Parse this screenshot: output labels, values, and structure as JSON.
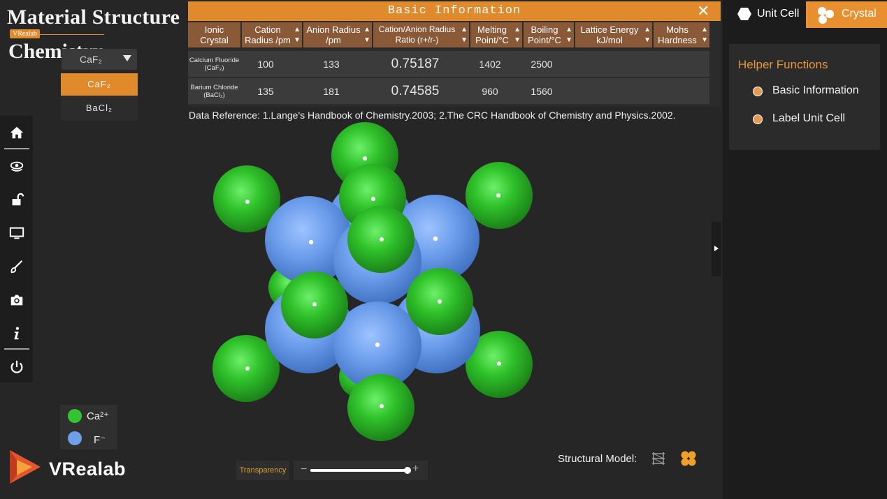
{
  "app": {
    "title_line1": "Material Structure",
    "title_line2": "Chemistry",
    "badge": "VRealab"
  },
  "crystal_select": {
    "selected": "CaF₂",
    "options": [
      "CaF₂",
      "BaCl₂"
    ]
  },
  "toolbar": {
    "items": [
      "home",
      "view",
      "unlock",
      "monitor",
      "brush",
      "camera",
      "info",
      "power"
    ]
  },
  "info_panel": {
    "title": "Basic Information",
    "close": "✕",
    "sort_glyph": "▲\n▼",
    "columns": [
      "Ionic Crystal",
      "Cation Radius /pm",
      "Anion Radius /pm",
      "Cation/Anion Radius Ratio (r+/r-)",
      "Melting Point/°C",
      "Boiling Point/°C",
      "Lattice Energy kJ/mol",
      "Mohs Hardness"
    ],
    "rows": [
      {
        "name": "Calcium Fluoride (CaF₂)",
        "cation": "100",
        "anion": "133",
        "ratio": "0.75187",
        "melting": "1402",
        "boiling": "2500",
        "lattice": "",
        "mohs": ""
      },
      {
        "name": "Barium Chloride (BaCl₂)",
        "cation": "135",
        "anion": "181",
        "ratio": "0.74585",
        "melting": "960",
        "boiling": "1560",
        "lattice": "",
        "mohs": ""
      }
    ],
    "reference": "Data Reference: 1.Lange's Handbook of Chemistry.2003; 2.The CRC Handbook of Chemistry and Physics.2002."
  },
  "legend": {
    "cation": {
      "label": "Ca²⁺",
      "color": "#33c433"
    },
    "anion": {
      "label": "F⁻",
      "color": "#6e9fe8"
    }
  },
  "brand": {
    "logo_text": "VRealab"
  },
  "transparency": {
    "label": "Transparency",
    "minus": "−",
    "plus": "+",
    "value": 0.98
  },
  "structural_model": {
    "label": "Structural Model:"
  },
  "right_panel": {
    "tabs": [
      "Unit Cell",
      "Crystal"
    ],
    "active_tab": "Crystal",
    "helper_title": "Helper Functions",
    "helper_items": [
      "Basic Information",
      "Label Unit Cell"
    ]
  }
}
